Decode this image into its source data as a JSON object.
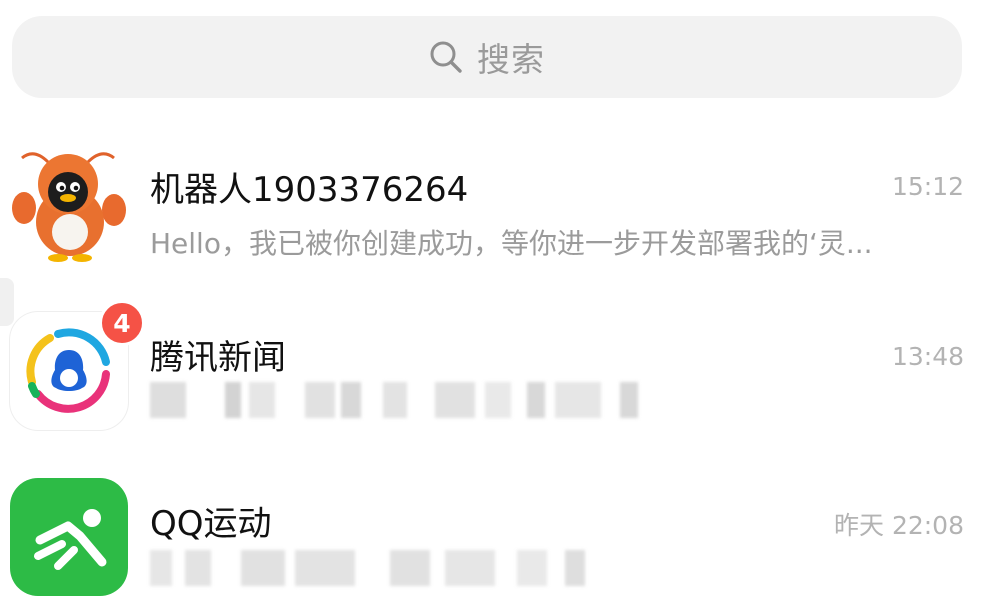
{
  "search": {
    "placeholder": "搜索",
    "icon": "search-icon"
  },
  "conversations": [
    {
      "name": "机器人1903376264",
      "time": "15:12",
      "preview": "Hello，我已被你创建成功，等你进一步开发部署我的‘灵...",
      "avatar": "lobster-penguin-avatar",
      "unread": null
    },
    {
      "name": "腾讯新闻",
      "time": "13:48",
      "preview": "",
      "avatar": "tencent-news-app-icon",
      "unread": "4"
    },
    {
      "name": "QQ运动",
      "time": "昨天 22:08",
      "preview": "",
      "avatar": "qq-sport-app-icon",
      "unread": null
    }
  ],
  "colors": {
    "badge": "#f55246",
    "qq_sport_green": "#2dbb46",
    "time_gray": "#b3b3b3"
  }
}
